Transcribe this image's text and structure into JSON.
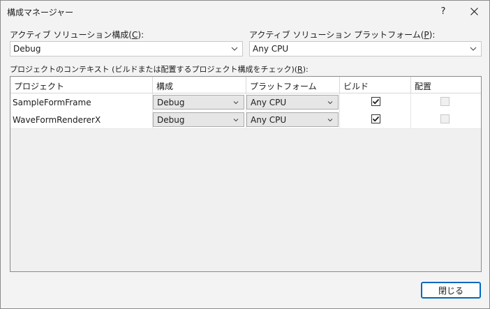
{
  "window": {
    "title": "構成マネージャー",
    "help_glyph": "?",
    "close_glyph": "✕"
  },
  "solution": {
    "config_label": "アクティブ ソリューション構成(",
    "config_key": "C",
    "config_label_end": "):",
    "config_value": "Debug",
    "platform_label": "アクティブ ソリューション プラットフォーム(",
    "platform_key": "P",
    "platform_label_end": "):",
    "platform_value": "Any CPU"
  },
  "grid": {
    "caption_start": "プロジェクトのコンテキスト (ビルドまたは配置するプロジェクト構成をチェック)(",
    "caption_key": "R",
    "caption_end": "):",
    "columns": [
      "プロジェクト",
      "構成",
      "プラットフォーム",
      "ビルド",
      "配置"
    ],
    "rows": [
      {
        "project": "SampleFormFrame",
        "config": "Debug",
        "platform": "Any CPU",
        "build": true,
        "deploy": false
      },
      {
        "project": "WaveFormRendererX",
        "config": "Debug",
        "platform": "Any CPU",
        "build": true,
        "deploy": false
      }
    ]
  },
  "footer": {
    "close_label": "閉じる"
  },
  "colors": {
    "accent": "#0067c0",
    "background": "#f3f3f3"
  }
}
